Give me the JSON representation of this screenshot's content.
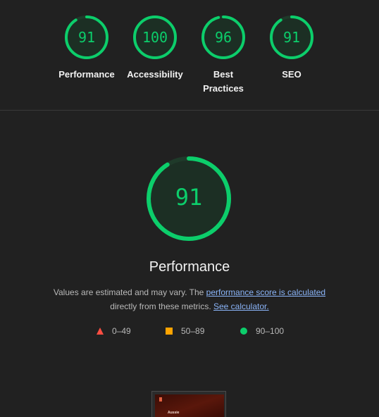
{
  "categories": [
    {
      "score": "91",
      "label": "Performance",
      "fraction": 0.91
    },
    {
      "score": "100",
      "label": "Accessibility",
      "fraction": 1.0
    },
    {
      "score": "96",
      "label": "Best Practices",
      "fraction": 0.96
    },
    {
      "score": "91",
      "label": "SEO",
      "fraction": 0.91
    }
  ],
  "main": {
    "score": "91",
    "fraction": 0.91,
    "title": "Performance",
    "desc_prefix": "Values are estimated and may vary. The ",
    "desc_link": "performance score is calculated",
    "desc_mid": " directly from these metrics. ",
    "desc_calc_link": "See calculator."
  },
  "legend": [
    {
      "shape": "triangle",
      "range": "0–49",
      "color": "#ff4e42"
    },
    {
      "shape": "square",
      "range": "50–89",
      "color": "#ffa400"
    },
    {
      "shape": "circle",
      "range": "90–100",
      "color": "#0cce6b"
    }
  ],
  "screenshot": {
    "text": "Aussie"
  },
  "colors": {
    "pass": "#0cce6b",
    "pass_bg": "#1f3a2a",
    "link": "#8ab4f8"
  }
}
